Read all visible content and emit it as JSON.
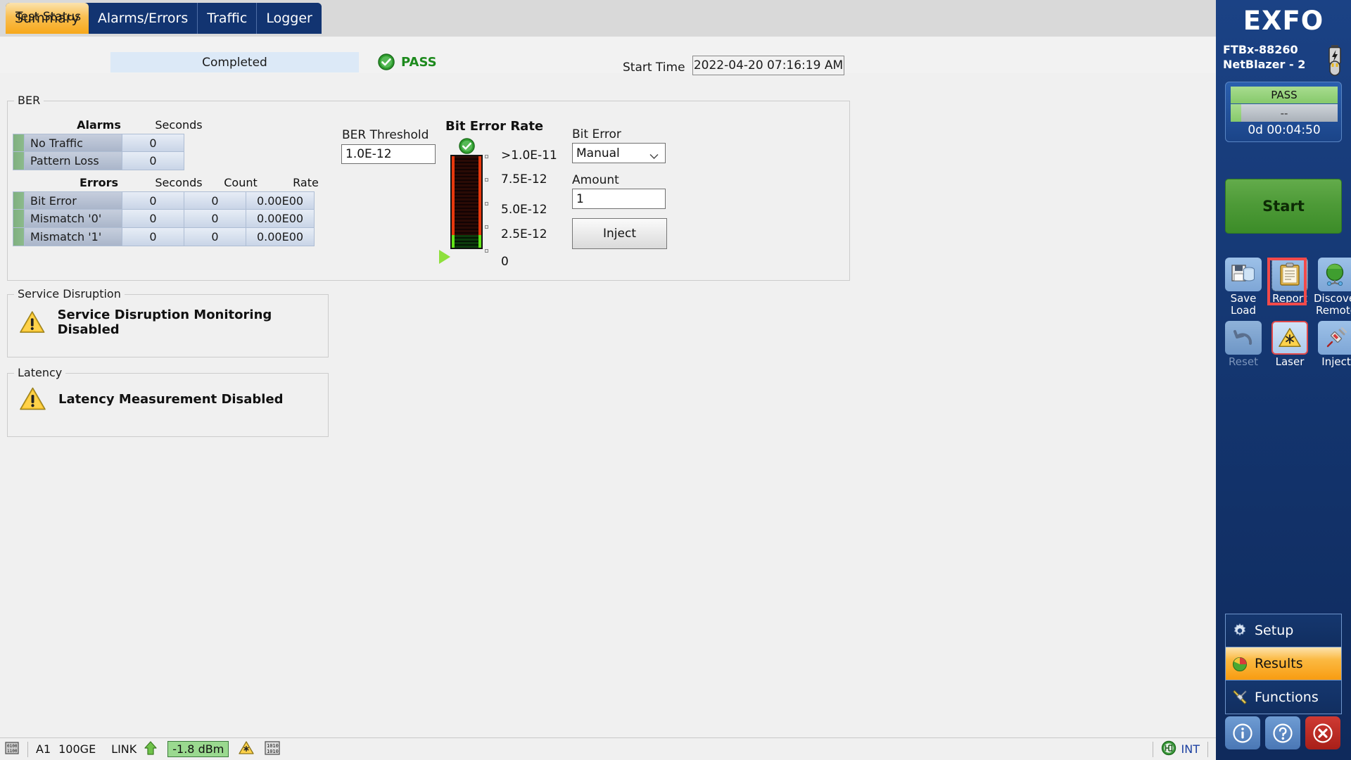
{
  "tabs": [
    {
      "label": "Summary",
      "active": true
    },
    {
      "label": "Alarms/Errors",
      "active": false
    },
    {
      "label": "Traffic",
      "active": false
    },
    {
      "label": "Logger",
      "active": false
    }
  ],
  "status": {
    "test_status_label": "Test Status",
    "test_status_value": "Completed",
    "verdict": "PASS",
    "start_time_label": "Start Time",
    "start_time_value": "2022-04-20 07:16:19 AM"
  },
  "ber": {
    "legend": "BER",
    "alarms_header": "Alarms",
    "alarms_seconds_header": "Seconds",
    "alarm_rows": [
      {
        "name": "No Traffic",
        "seconds": "0"
      },
      {
        "name": "Pattern Loss",
        "seconds": "0"
      }
    ],
    "errors_header": "Errors",
    "errors_columns": [
      "Seconds",
      "Count",
      "Rate"
    ],
    "error_rows": [
      {
        "name": "Bit Error",
        "seconds": "0",
        "count": "0",
        "rate": "0.00E00"
      },
      {
        "name": "Mismatch '0'",
        "seconds": "0",
        "count": "0",
        "rate": "0.00E00"
      },
      {
        "name": "Mismatch '1'",
        "seconds": "0",
        "count": "0",
        "rate": "0.00E00"
      }
    ],
    "threshold_label": "BER Threshold",
    "threshold_value": "1.0E-12",
    "gauge_title": "Bit Error Rate",
    "gauge_ticks": [
      ">1.0E-11",
      "7.5E-12",
      "5.0E-12",
      "2.5E-12",
      "0"
    ],
    "bit_error_label": "Bit Error",
    "bit_error_mode": "Manual",
    "bit_error_options": [
      "Manual"
    ],
    "amount_label": "Amount",
    "amount_value": "1",
    "inject_label": "Inject"
  },
  "service_disruption": {
    "legend": "Service Disruption",
    "message": "Service Disruption Monitoring Disabled"
  },
  "latency": {
    "legend": "Latency",
    "message": "Latency Measurement Disabled"
  },
  "statusbar": {
    "port": "A1",
    "rate": "100GE",
    "link": "LINK",
    "power": "-1.8 dBm",
    "clock": "INT"
  },
  "sidebar": {
    "brand": "EXFO",
    "device_line1": "FTBx-88260",
    "device_line2": "NetBlazer - 2",
    "verdict": "PASS",
    "second_value": "--",
    "elapsed": "0d 00:04:50",
    "start_button": "Start",
    "tools": [
      {
        "name": "save-load",
        "line1": "Save",
        "line2": "Load",
        "enabled": true
      },
      {
        "name": "report",
        "line1": "Report",
        "line2": "",
        "enabled": true,
        "selected": true
      },
      {
        "name": "discover-remote",
        "line1": "Discover",
        "line2": "Remote",
        "enabled": true
      },
      {
        "name": "reset",
        "line1": "Reset",
        "line2": "",
        "enabled": false
      },
      {
        "name": "laser",
        "line1": "Laser",
        "line2": "",
        "enabled": true
      },
      {
        "name": "inject",
        "line1": "Inject",
        "line2": "",
        "enabled": true
      }
    ],
    "nav": [
      {
        "label": "Setup",
        "icon": "gear-icon",
        "active": false
      },
      {
        "label": "Results",
        "icon": "pie-chart-icon",
        "active": true
      },
      {
        "label": "Functions",
        "icon": "tools-icon",
        "active": false
      }
    ],
    "nav_buttons": [
      "info-icon",
      "help-icon",
      "close-icon"
    ]
  },
  "colors": {
    "accent_orange": "#f7a81a",
    "nav_blue": "#123471",
    "pass_green": "#1d8a1d",
    "highlight_red": "#f24a4a"
  }
}
